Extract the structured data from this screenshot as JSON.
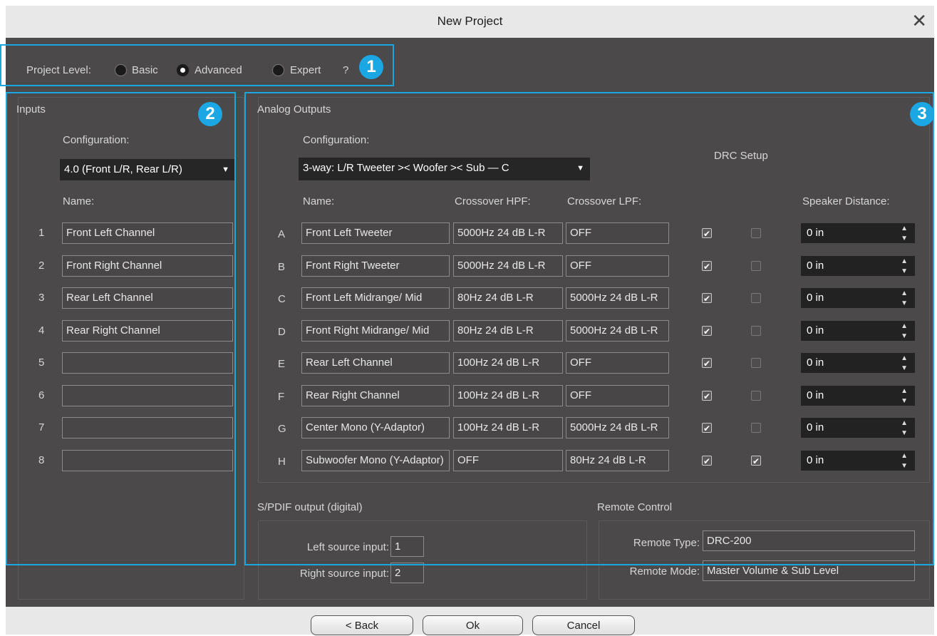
{
  "window": {
    "title": "New Project",
    "close_icon": "close-icon"
  },
  "project_level": {
    "label": "Project Level:",
    "options": [
      "Basic",
      "Advanced",
      "Expert"
    ],
    "selected": "Advanced",
    "help": "?"
  },
  "badges": [
    "1",
    "2",
    "3"
  ],
  "inputs": {
    "title": "Inputs",
    "config_label": "Configuration:",
    "config_value": "4.0 (Front L/R, Rear L/R)",
    "name_label": "Name:",
    "channels": [
      {
        "num": "1",
        "name": "Front Left Channel"
      },
      {
        "num": "2",
        "name": "Front Right Channel"
      },
      {
        "num": "3",
        "name": "Rear Left Channel"
      },
      {
        "num": "4",
        "name": "Rear Right Channel"
      },
      {
        "num": "5",
        "name": ""
      },
      {
        "num": "6",
        "name": ""
      },
      {
        "num": "7",
        "name": ""
      },
      {
        "num": "8",
        "name": ""
      }
    ]
  },
  "outputs": {
    "title": "Analog Outputs",
    "config_label": "Configuration:",
    "config_value": "3-way: L/R Tweeter >< Woofer >< Sub — C",
    "drc_label": "DRC Setup",
    "headers": {
      "name": "Name:",
      "hpf": "Crossover HPF:",
      "lpf": "Crossover LPF:",
      "distance": "Speaker Distance:"
    },
    "channels": [
      {
        "letter": "A",
        "name": "Front Left Tweeter",
        "hpf": "5000Hz 24 dB L-R",
        "lpf": "OFF",
        "drc1": true,
        "drc2": false,
        "distance": "0 in"
      },
      {
        "letter": "B",
        "name": "Front Right Tweeter",
        "hpf": "5000Hz 24 dB L-R",
        "lpf": "OFF",
        "drc1": true,
        "drc2": false,
        "distance": "0 in"
      },
      {
        "letter": "C",
        "name": "Front Left Midrange/ Mid",
        "hpf": "80Hz 24 dB L-R",
        "lpf": "5000Hz 24 dB L-R",
        "drc1": true,
        "drc2": false,
        "distance": "0 in"
      },
      {
        "letter": "D",
        "name": "Front Right Midrange/ Mid",
        "hpf": "80Hz 24 dB L-R",
        "lpf": "5000Hz 24 dB L-R",
        "drc1": true,
        "drc2": false,
        "distance": "0 in"
      },
      {
        "letter": "E",
        "name": "Rear Left Channel",
        "hpf": "100Hz 24 dB L-R",
        "lpf": "OFF",
        "drc1": true,
        "drc2": false,
        "distance": "0 in"
      },
      {
        "letter": "F",
        "name": "Rear Right Channel",
        "hpf": "100Hz 24 dB L-R",
        "lpf": "OFF",
        "drc1": true,
        "drc2": false,
        "distance": "0 in"
      },
      {
        "letter": "G",
        "name": "Center Mono (Y-Adaptor)",
        "hpf": "100Hz 24 dB L-R",
        "lpf": "5000Hz 24 dB L-R",
        "drc1": true,
        "drc2": false,
        "distance": "0 in"
      },
      {
        "letter": "H",
        "name": "Subwoofer Mono (Y-Adaptor)",
        "hpf": "OFF",
        "lpf": "80Hz 24 dB L-R",
        "drc1": true,
        "drc2": true,
        "distance": "0 in"
      }
    ]
  },
  "spdif": {
    "title": "S/PDIF output (digital)",
    "left_label": "Left source input:",
    "left_value": "1",
    "right_label": "Right source input:",
    "right_value": "2"
  },
  "remote": {
    "title": "Remote Control",
    "type_label": "Remote Type:",
    "type_value": "DRC-200",
    "mode_label": "Remote Mode:",
    "mode_value": "Master Volume & Sub Level"
  },
  "buttons": {
    "back": "< Back",
    "ok": "Ok",
    "cancel": "Cancel"
  },
  "colors": {
    "window_bg": "#4b4949",
    "highlight": "#1aa6e0",
    "titlebar": "#e8e8e8"
  }
}
